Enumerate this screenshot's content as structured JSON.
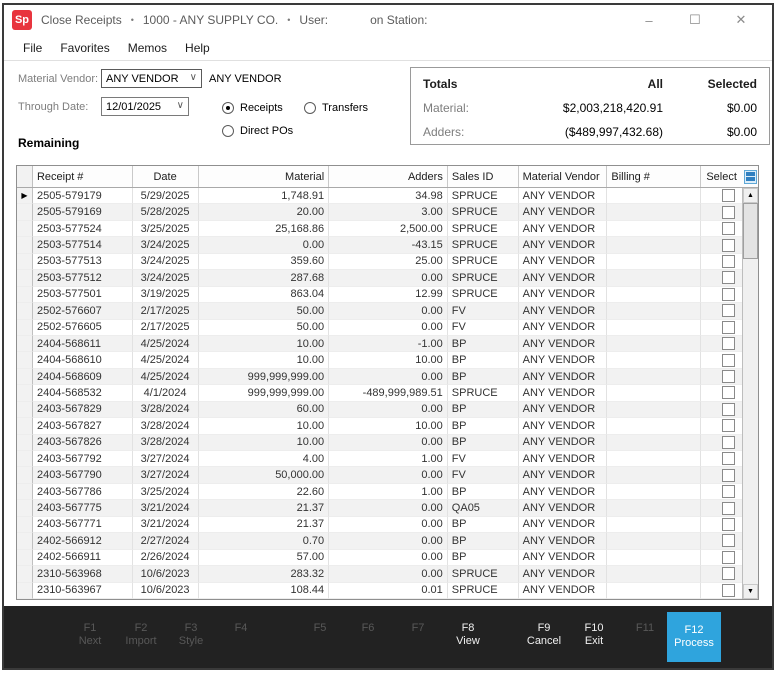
{
  "window": {
    "logo": "Sp",
    "app_title": "Close Receipts",
    "separator": "•",
    "company": "1000 - ANY SUPPLY CO.",
    "user_label": "User:",
    "station_label": "on Station:",
    "minimize": "–",
    "maximize": "☐",
    "close": "✕"
  },
  "menu": {
    "items": [
      "File",
      "Favorites",
      "Memos",
      "Help"
    ]
  },
  "filters": {
    "material_vendor_label": "Material Vendor:",
    "material_vendor_value": "ANY VENDOR",
    "material_vendor_name": "ANY VENDOR",
    "through_date_label": "Through Date:",
    "through_date_value": "12/01/2025",
    "radios": [
      {
        "label": "Receipts",
        "selected": true
      },
      {
        "label": "Transfers",
        "selected": false
      },
      {
        "label": "Direct POs",
        "selected": false
      }
    ]
  },
  "totals": {
    "title": "Totals",
    "col_all": "All",
    "col_selected": "Selected",
    "rows": [
      {
        "label": "Material:",
        "all": "$2,003,218,420.91",
        "selected": "$0.00"
      },
      {
        "label": "Adders:",
        "all": "($489,997,432.68)",
        "selected": "$0.00"
      }
    ]
  },
  "grid": {
    "section_label": "Remaining",
    "columns": [
      "Receipt #",
      "Date",
      "Material",
      "Adders",
      "Sales ID",
      "Material Vendor",
      "Billing #",
      "Select"
    ],
    "current_row_indicator": "▶",
    "rows": [
      {
        "receipt": "2505-579179",
        "date": "5/29/2025",
        "material": "1,748.91",
        "adders": "34.98",
        "sales_id": "SPRUCE",
        "vendor": "ANY VENDOR",
        "billing": ""
      },
      {
        "receipt": "2505-579169",
        "date": "5/28/2025",
        "material": "20.00",
        "adders": "3.00",
        "sales_id": "SPRUCE",
        "vendor": "ANY VENDOR",
        "billing": ""
      },
      {
        "receipt": "2503-577524",
        "date": "3/25/2025",
        "material": "25,168.86",
        "adders": "2,500.00",
        "sales_id": "SPRUCE",
        "vendor": "ANY VENDOR",
        "billing": ""
      },
      {
        "receipt": "2503-577514",
        "date": "3/24/2025",
        "material": "0.00",
        "adders": "-43.15",
        "sales_id": "SPRUCE",
        "vendor": "ANY VENDOR",
        "billing": ""
      },
      {
        "receipt": "2503-577513",
        "date": "3/24/2025",
        "material": "359.60",
        "adders": "25.00",
        "sales_id": "SPRUCE",
        "vendor": "ANY VENDOR",
        "billing": ""
      },
      {
        "receipt": "2503-577512",
        "date": "3/24/2025",
        "material": "287.68",
        "adders": "0.00",
        "sales_id": "SPRUCE",
        "vendor": "ANY VENDOR",
        "billing": ""
      },
      {
        "receipt": "2503-577501",
        "date": "3/19/2025",
        "material": "863.04",
        "adders": "12.99",
        "sales_id": "SPRUCE",
        "vendor": "ANY VENDOR",
        "billing": ""
      },
      {
        "receipt": "2502-576607",
        "date": "2/17/2025",
        "material": "50.00",
        "adders": "0.00",
        "sales_id": "FV",
        "vendor": "ANY VENDOR",
        "billing": ""
      },
      {
        "receipt": "2502-576605",
        "date": "2/17/2025",
        "material": "50.00",
        "adders": "0.00",
        "sales_id": "FV",
        "vendor": "ANY VENDOR",
        "billing": ""
      },
      {
        "receipt": "2404-568611",
        "date": "4/25/2024",
        "material": "10.00",
        "adders": "-1.00",
        "sales_id": "BP",
        "vendor": "ANY VENDOR",
        "billing": ""
      },
      {
        "receipt": "2404-568610",
        "date": "4/25/2024",
        "material": "10.00",
        "adders": "10.00",
        "sales_id": "BP",
        "vendor": "ANY VENDOR",
        "billing": ""
      },
      {
        "receipt": "2404-568609",
        "date": "4/25/2024",
        "material": "999,999,999.00",
        "adders": "0.00",
        "sales_id": "BP",
        "vendor": "ANY VENDOR",
        "billing": ""
      },
      {
        "receipt": "2404-568532",
        "date": "4/1/2024",
        "material": "999,999,999.00",
        "adders": "-489,999,989.51",
        "sales_id": "SPRUCE",
        "vendor": "ANY VENDOR",
        "billing": ""
      },
      {
        "receipt": "2403-567829",
        "date": "3/28/2024",
        "material": "60.00",
        "adders": "0.00",
        "sales_id": "BP",
        "vendor": "ANY VENDOR",
        "billing": ""
      },
      {
        "receipt": "2403-567827",
        "date": "3/28/2024",
        "material": "10.00",
        "adders": "10.00",
        "sales_id": "BP",
        "vendor": "ANY VENDOR",
        "billing": ""
      },
      {
        "receipt": "2403-567826",
        "date": "3/28/2024",
        "material": "10.00",
        "adders": "0.00",
        "sales_id": "BP",
        "vendor": "ANY VENDOR",
        "billing": ""
      },
      {
        "receipt": "2403-567792",
        "date": "3/27/2024",
        "material": "4.00",
        "adders": "1.00",
        "sales_id": "FV",
        "vendor": "ANY VENDOR",
        "billing": ""
      },
      {
        "receipt": "2403-567790",
        "date": "3/27/2024",
        "material": "50,000.00",
        "adders": "0.00",
        "sales_id": "FV",
        "vendor": "ANY VENDOR",
        "billing": ""
      },
      {
        "receipt": "2403-567786",
        "date": "3/25/2024",
        "material": "22.60",
        "adders": "1.00",
        "sales_id": "BP",
        "vendor": "ANY VENDOR",
        "billing": ""
      },
      {
        "receipt": "2403-567775",
        "date": "3/21/2024",
        "material": "21.37",
        "adders": "0.00",
        "sales_id": "QA05",
        "vendor": "ANY VENDOR",
        "billing": ""
      },
      {
        "receipt": "2403-567771",
        "date": "3/21/2024",
        "material": "21.37",
        "adders": "0.00",
        "sales_id": "BP",
        "vendor": "ANY VENDOR",
        "billing": ""
      },
      {
        "receipt": "2402-566912",
        "date": "2/27/2024",
        "material": "0.70",
        "adders": "0.00",
        "sales_id": "BP",
        "vendor": "ANY VENDOR",
        "billing": ""
      },
      {
        "receipt": "2402-566911",
        "date": "2/26/2024",
        "material": "57.00",
        "adders": "0.00",
        "sales_id": "BP",
        "vendor": "ANY VENDOR",
        "billing": ""
      },
      {
        "receipt": "2310-563968",
        "date": "10/6/2023",
        "material": "283.32",
        "adders": "0.00",
        "sales_id": "SPRUCE",
        "vendor": "ANY VENDOR",
        "billing": ""
      },
      {
        "receipt": "2310-563967",
        "date": "10/6/2023",
        "material": "108.44",
        "adders": "0.01",
        "sales_id": "SPRUCE",
        "vendor": "ANY VENDOR",
        "billing": ""
      }
    ]
  },
  "fnbar": {
    "keys": [
      {
        "key": "F1",
        "label": "Next",
        "state": "disabled"
      },
      {
        "key": "F2",
        "label": "Import",
        "state": "disabled"
      },
      {
        "key": "F3",
        "label": "Style",
        "state": "disabled"
      },
      {
        "key": "F4",
        "label": "",
        "state": "disabled"
      },
      {
        "key": "F5",
        "label": "",
        "state": "disabled"
      },
      {
        "key": "F6",
        "label": "",
        "state": "disabled"
      },
      {
        "key": "F7",
        "label": "",
        "state": "disabled"
      },
      {
        "key": "F8",
        "label": "View",
        "state": "enabled"
      },
      {
        "key": "F9",
        "label": "Cancel",
        "state": "enabled"
      },
      {
        "key": "F10",
        "label": "Exit",
        "state": "enabled"
      },
      {
        "key": "F11",
        "label": "",
        "state": "disabled"
      },
      {
        "key": "F12",
        "label": "Process",
        "state": "primary"
      }
    ]
  },
  "colors": {
    "accent_blue": "#2fa4dd",
    "logo_red": "#e8353e",
    "fnbar_bg": "#222222"
  }
}
